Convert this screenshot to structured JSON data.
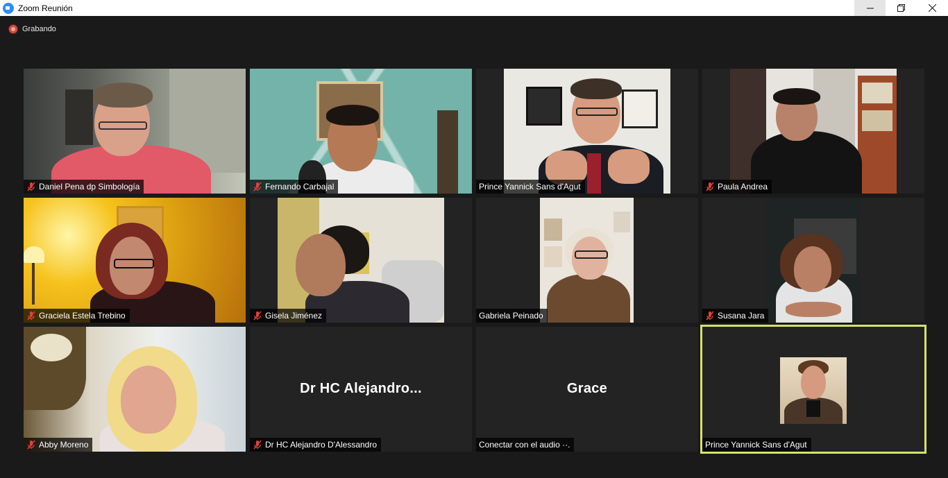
{
  "window": {
    "title": "Zoom Reunión",
    "controls": {
      "minimize": "—",
      "restore": "❐",
      "close": "✕"
    }
  },
  "recording": {
    "label": "Grabando"
  },
  "participants": [
    {
      "name": "Daniel Pena dp Simbología",
      "muted": true
    },
    {
      "name": "Fernando Carbajal",
      "muted": true
    },
    {
      "name": "Prince Yannick Sans d'Agut",
      "muted": false
    },
    {
      "name": "Paula Andrea",
      "muted": true
    },
    {
      "name": "Graciela Estela Trebino",
      "muted": true
    },
    {
      "name": "Gisela Jiménez",
      "muted": true
    },
    {
      "name": "Gabriela Peinado",
      "muted": false
    },
    {
      "name": "Susana Jara",
      "muted": true
    },
    {
      "name": "Abby Moreno",
      "muted": true
    },
    {
      "name": "Dr HC Alejandro D'Alessandro",
      "display_name": "Dr HC Alejandro...",
      "muted": true,
      "video": false
    },
    {
      "name": "Conectar con el audio ··.",
      "display_name": "Grace",
      "muted": false,
      "video": false
    },
    {
      "name": "Prince Yannick Sans d'Agut",
      "muted": false,
      "video": false,
      "speaking": true
    }
  ],
  "colors": {
    "active_speaker_border": "#d6e26b",
    "muted_icon": "#e0413a",
    "recording": "#d74a3c"
  }
}
